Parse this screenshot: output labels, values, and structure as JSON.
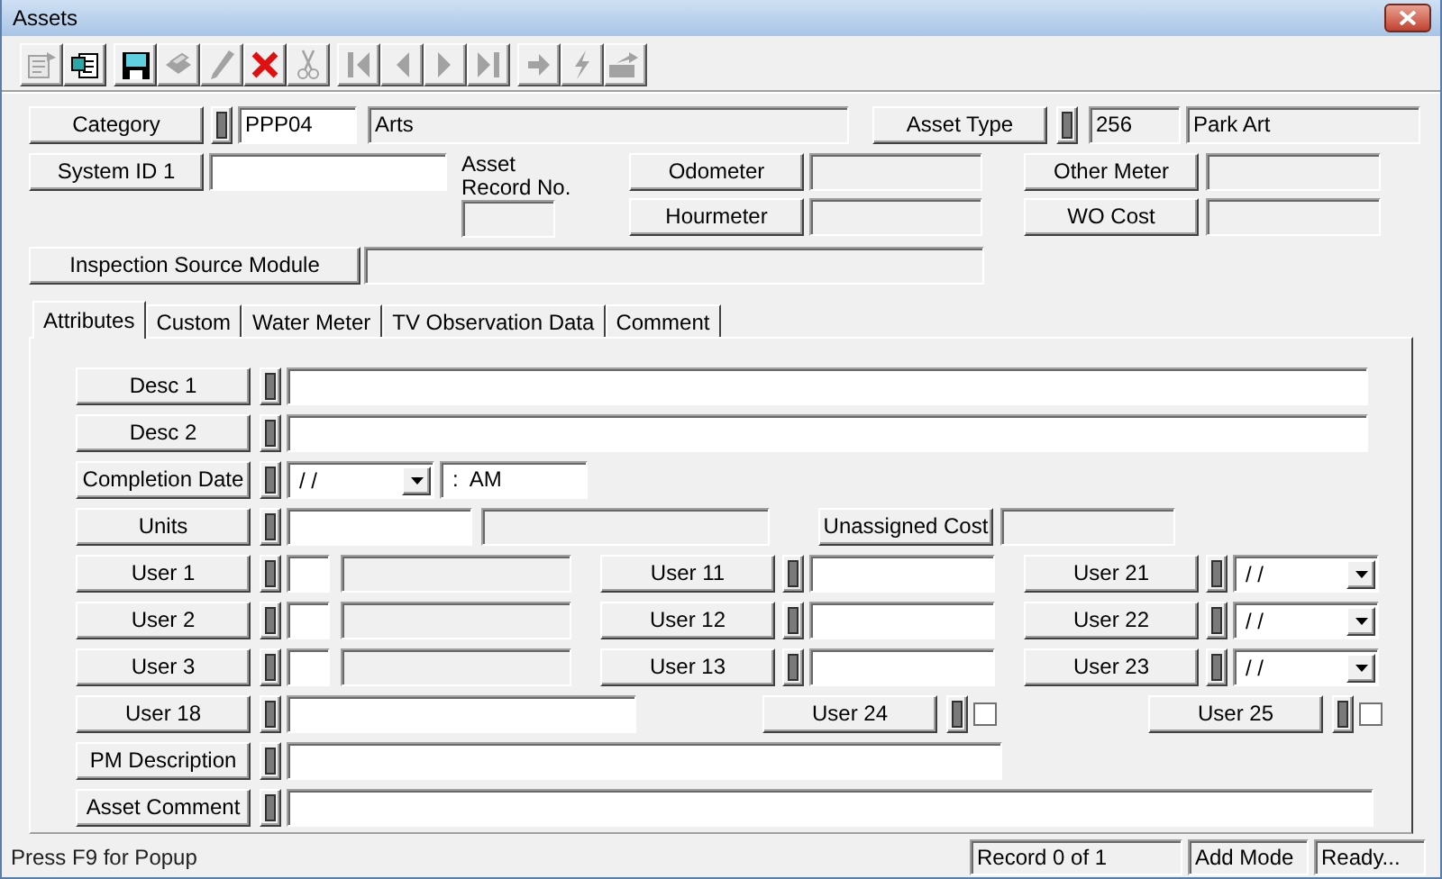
{
  "window": {
    "title": "Assets"
  },
  "toolbar": [
    {
      "kind": "properties",
      "disabled": true
    },
    {
      "kind": "copy",
      "disabled": false
    },
    {
      "kind": "save",
      "disabled": false
    },
    {
      "kind": "print",
      "disabled": true
    },
    {
      "kind": "edit",
      "disabled": true
    },
    {
      "kind": "delete",
      "disabled": false
    },
    {
      "kind": "cut",
      "disabled": true
    },
    {
      "kind": "first",
      "disabled": true
    },
    {
      "kind": "previous",
      "disabled": true
    },
    {
      "kind": "next",
      "disabled": true
    },
    {
      "kind": "last",
      "disabled": true
    },
    {
      "kind": "forward",
      "disabled": true
    },
    {
      "kind": "lightning",
      "disabled": true
    },
    {
      "kind": "export",
      "disabled": true
    }
  ],
  "header": {
    "category": {
      "label": "Category",
      "code": "PPP04",
      "description": "Arts"
    },
    "asset_type": {
      "label": "Asset Type",
      "code": "256",
      "description": "Park Art"
    },
    "system_id": {
      "label": "System ID 1"
    },
    "asset_record_no": {
      "label": "Asset Record No."
    },
    "odometer": {
      "label": "Odometer"
    },
    "hourmeter": {
      "label": "Hourmeter"
    },
    "other_meter": {
      "label": "Other Meter"
    },
    "wo_cost": {
      "label": "WO Cost"
    },
    "inspection_source_module": {
      "label": "Inspection Source Module"
    }
  },
  "tabs": [
    {
      "label": "Attributes",
      "selected": true
    },
    {
      "label": "Custom",
      "selected": false
    },
    {
      "label": "Water Meter",
      "selected": false
    },
    {
      "label": "TV Observation Data",
      "selected": false
    },
    {
      "label": "Comment",
      "selected": false
    }
  ],
  "attributes": {
    "desc_1": {
      "label": "Desc 1"
    },
    "desc_2": {
      "label": "Desc 2"
    },
    "completion_date": {
      "label": "Completion Date",
      "date": "/ /",
      "time": ":  AM"
    },
    "units": {
      "label": "Units"
    },
    "unassigned_cost": {
      "label": "Unassigned Cost"
    },
    "user_rows": [
      {
        "left": "User 1",
        "middle": "User 11",
        "right": "User 21",
        "right_date": "/ /"
      },
      {
        "left": "User 2",
        "middle": "User 12",
        "right": "User 22",
        "right_date": "/ /"
      },
      {
        "left": "User 3",
        "middle": "User 13",
        "right": "User 23",
        "right_date": "/ /"
      }
    ],
    "user_18": {
      "label": "User 18"
    },
    "user_24": {
      "label": "User 24",
      "checked": false
    },
    "user_25": {
      "label": "User 25",
      "checked": false
    },
    "pm_description": {
      "label": "PM Description"
    },
    "asset_comment": {
      "label": "Asset Comment"
    }
  },
  "status_bar": {
    "hint": "Press F9 for Popup",
    "record": "Record 0 of 1",
    "mode": "Add Mode",
    "status": "Ready..."
  }
}
